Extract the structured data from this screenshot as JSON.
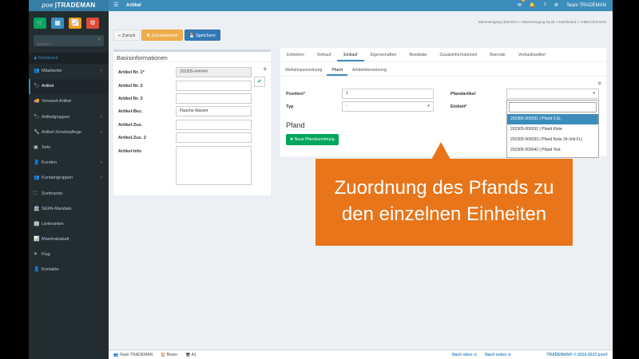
{
  "app": {
    "brand_prefix": "poe",
    "brand_name": "TRADEMAN",
    "page_title": "Artikel"
  },
  "sidebar": {
    "search_placeholder": "Suchen...",
    "nav_header": "Dashboard",
    "items": [
      {
        "label": "Mitarbeiter",
        "icon": "users-icon",
        "chevron": true
      },
      {
        "label": "Artikel",
        "icon": "tag-icon",
        "chevron": false,
        "active": true
      },
      {
        "label": "Versand-Artikel",
        "icon": "truck-icon",
        "chevron": false
      },
      {
        "label": "Artikelgruppen",
        "icon": "tags-icon",
        "chevron": true
      },
      {
        "label": "Artikel-Sonderpflege",
        "icon": "wrench-icon",
        "chevron": true
      },
      {
        "label": "Sets",
        "icon": "cubes-icon",
        "chevron": false
      },
      {
        "label": "Kunden",
        "icon": "user-icon",
        "chevron": true
      },
      {
        "label": "Kundengruppen",
        "icon": "group-icon",
        "chevron": true
      },
      {
        "label": "Sortimente",
        "icon": "sitemap-icon",
        "chevron": false
      },
      {
        "label": "SEPA-Mandate",
        "icon": "bank-icon",
        "chevron": false
      },
      {
        "label": "Lieferanten",
        "icon": "building-icon",
        "chevron": false
      },
      {
        "label": "Maximalrabatt",
        "icon": "chart-icon",
        "chevron": false
      },
      {
        "label": "Flug",
        "icon": "plane-icon",
        "chevron": false
      },
      {
        "label": "Kontakte",
        "icon": "contact-icon",
        "chevron": false
      }
    ]
  },
  "topbar": {
    "user": "Team TRADEMAN",
    "mail_badge": "3"
  },
  "breadcrumb": "Wareneingang Übersicht  >  Wareneingang NL48  >  Dashboard  >  Artikel Übersicht",
  "toolbar": {
    "back": "« Zurück",
    "reset": "✖ Zurücksetzen",
    "save": "💾 Speichern"
  },
  "basis": {
    "title": "Basisinformationen",
    "fields": [
      {
        "label": "Artikel Nr. 1*",
        "value": "202305-######"
      },
      {
        "label": "Artikel Nr. 2",
        "value": ""
      },
      {
        "label": "Artikel Nr. 3",
        "value": ""
      },
      {
        "label": "Artikel-Bez.",
        "value": "Flasche Wasser"
      },
      {
        "label": "Artikel-Zus.",
        "value": ""
      },
      {
        "label": "Artikel-Zus. 2",
        "value": ""
      },
      {
        "label": "Artikel-Info",
        "value": ""
      }
    ]
  },
  "tabs": [
    "Einheiten",
    "Verkauf",
    "Einkauf",
    "Eigenschaften",
    "Bestände",
    "Zusatzinformationen",
    "Barcode",
    "Verkaufsartikel"
  ],
  "subtabs": [
    "Webshopzuordnung",
    "Pfand",
    "Artikelübersetzung"
  ],
  "pfand_form": {
    "position_label": "Position*",
    "position_value": "1",
    "typ_label": "Typ",
    "typ_value": "-",
    "pfandartikel_label": "Pfandartikel",
    "pfandartikel_value": "",
    "einheit_label": "Einheit*",
    "heading": "Pfand",
    "add_button": "✚ Neue Pfandzuordnung"
  },
  "dropdown": {
    "search_value": "",
    "options": [
      "202305-000031 | Pfand 0,5L",
      "202305-000032 | Pfand Kiste",
      "202305-000033 | Pfand Kiste 24 (mit FL)",
      "202305-000042 | Pfand Test"
    ]
  },
  "footer": {
    "user": "Team TRADEMAN",
    "branch": "Boren",
    "terminal": "A1",
    "nav_up": "Nach oben",
    "nav_down": "Nach unten",
    "copyright": "TRADEMAN® © 2010-2023 poe®"
  },
  "callout": {
    "line1": "Zuordnung des Pfands zu",
    "line2": "den einzelnen Einheiten",
    "color": "#e8751a"
  }
}
